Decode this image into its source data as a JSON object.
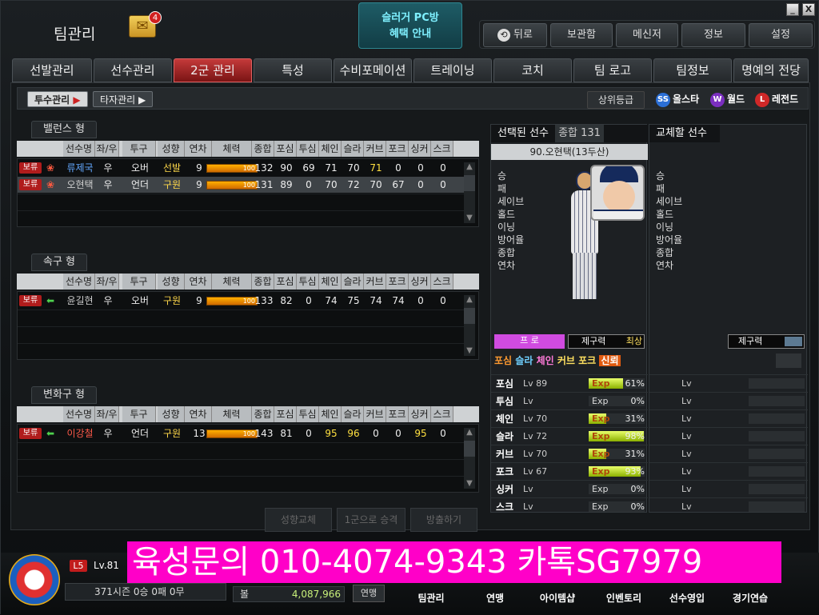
{
  "window": {
    "title": "팀관리",
    "mail_count": "4",
    "minimize": "_",
    "close": "X"
  },
  "promo": {
    "line1": "슬러거 PC방",
    "line2": "혜택 안내"
  },
  "topbar": {
    "back": "뒤로",
    "storage": "보관함",
    "messenger": "메신저",
    "info": "정보",
    "settings": "설정"
  },
  "tabs": [
    "선발관리",
    "선수관리",
    "2군 관리",
    "특성",
    "수비포메이션",
    "트레이닝",
    "코치",
    "팀 로고",
    "팀정보",
    "명예의 전당"
  ],
  "active_tab": "2군 관리",
  "subtabs": {
    "pitcher": "투수관리",
    "batter": "타자관리"
  },
  "grades": {
    "upper": "상위등급",
    "allstar": "올스타",
    "world": "월드",
    "legend": "레전드",
    "ss": "SS",
    "w": "W",
    "l": "L"
  },
  "columns": [
    "선수명",
    "좌/우",
    "투구",
    "성향",
    "연차",
    "체력",
    "종합",
    "포심",
    "투심",
    "체인",
    "슬라",
    "커브",
    "포크",
    "싱커",
    "스크"
  ],
  "sections": [
    {
      "title": "밸런스 형",
      "rows": [
        {
          "tag": "보류",
          "name": "류제국",
          "hand": "우",
          "style": "오버",
          "type": "선발",
          "year": "9",
          "stamina": "100",
          "ovr": "132",
          "v": [
            "90",
            "69",
            "71",
            "70",
            "71",
            "0",
            "0",
            "0"
          ],
          "name_color": "#63a8ff",
          "type_color": "#ffd84a",
          "hi": [
            4
          ]
        },
        {
          "tag": "보류",
          "name": "오현택",
          "hand": "우",
          "style": "언더",
          "type": "구원",
          "year": "9",
          "stamina": "100",
          "ovr": "131",
          "v": [
            "89",
            "0",
            "70",
            "72",
            "70",
            "67",
            "0",
            "0"
          ],
          "name_color": "#cfcfcf",
          "type_color": "#ffd84a",
          "hi": [],
          "selected": true
        }
      ]
    },
    {
      "title": "속구 형",
      "rows": [
        {
          "tag": "보류",
          "name": "윤길현",
          "hand": "우",
          "style": "오버",
          "type": "구원",
          "year": "9",
          "stamina": "100",
          "ovr": "133",
          "v": [
            "82",
            "0",
            "74",
            "75",
            "74",
            "74",
            "0",
            "0"
          ],
          "name_color": "#cfcfcf",
          "type_color": "#ffd84a",
          "hi": []
        }
      ]
    },
    {
      "title": "변화구 형",
      "rows": [
        {
          "tag": "보류",
          "name": "이강철",
          "hand": "우",
          "style": "언더",
          "type": "구원",
          "year": "13",
          "stamina": "100",
          "ovr": "143",
          "v": [
            "81",
            "0",
            "95",
            "96",
            "0",
            "0",
            "95",
            "0"
          ],
          "name_color": "#ff5a4a",
          "type_color": "#ffd84a",
          "hi": [
            2,
            3,
            6
          ]
        }
      ]
    }
  ],
  "selected_player": {
    "header": "선택된 선수",
    "overall_label": "종합",
    "overall": "131",
    "name": "90.오현택(13두산)",
    "stats": [
      "승",
      "패",
      "세이브",
      "홀드",
      "이닝",
      "방어율",
      "종합",
      "연차"
    ],
    "grade": "프 로",
    "control_label": "제구력",
    "control_value": "최상",
    "pitch_list": [
      "포심",
      "슬라",
      "체인",
      "커브",
      "포크",
      "신뢰"
    ],
    "pitches": [
      {
        "name": "포심",
        "lv": "Lv 89",
        "exp": "Exp",
        "pct": "61%",
        "fill": 0.61
      },
      {
        "name": "투심",
        "lv": "Lv",
        "exp": "Exp",
        "pct": "0%",
        "fill": 0
      },
      {
        "name": "체인",
        "lv": "Lv 70",
        "exp": "Exp",
        "pct": "31%",
        "fill": 0.31
      },
      {
        "name": "슬라",
        "lv": "Lv 72",
        "exp": "Exp",
        "pct": "98%",
        "fill": 0.98
      },
      {
        "name": "커브",
        "lv": "Lv 70",
        "exp": "Exp",
        "pct": "31%",
        "fill": 0.31
      },
      {
        "name": "포크",
        "lv": "Lv 67",
        "exp": "Exp",
        "pct": "93%",
        "fill": 0.93
      },
      {
        "name": "싱커",
        "lv": "Lv",
        "exp": "Exp",
        "pct": "0%",
        "fill": 0
      },
      {
        "name": "스크",
        "lv": "Lv",
        "exp": "Exp",
        "pct": "0%",
        "fill": 0
      }
    ]
  },
  "swap_player": {
    "header": "교체할 선수",
    "stats": [
      "승",
      "패",
      "세이브",
      "홀드",
      "이닝",
      "방어율",
      "종합",
      "연차"
    ],
    "control_label": "제구력",
    "lv": "Lv"
  },
  "actions": {
    "change": "성향교체",
    "promote": "1군으로 승격",
    "release": "방출하기"
  },
  "status": {
    "level": "L5",
    "lv": "Lv.81",
    "season": "371시즌",
    "wins": "0승",
    "draws": "0패",
    "losses": "0무",
    "currency_label": "볼",
    "currency": "4,087,966",
    "league": "연맹"
  },
  "bottom_nav": [
    "팀관리",
    "연맹",
    "아이템샵",
    "인벤토리",
    "선수영입",
    "경기연습"
  ],
  "ad_text": "육성문의 010-4074-9343 카톡SG7979"
}
